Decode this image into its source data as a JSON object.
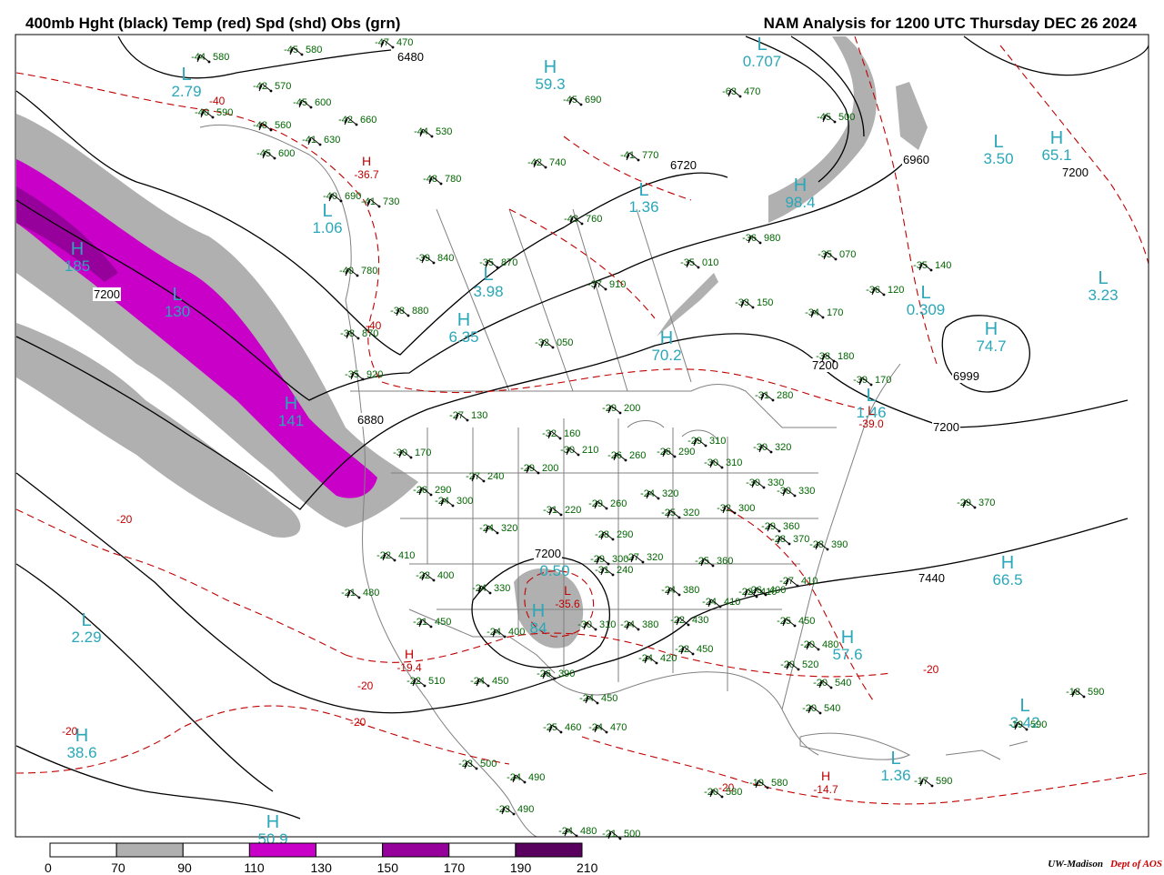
{
  "header": {
    "left_title": "400mb Hght (black) Temp (red) Spd (shd) Obs (grn)",
    "right_title": "NAM Analysis for 1200 UTC Thursday  DEC 26 2024"
  },
  "colors": {
    "height": "#000000",
    "temp": "#c00000",
    "obs": "#006400",
    "centers": "#2aa7b8",
    "border": "#808080",
    "shade_70": "#b0b0b0",
    "shade_110": "#c800c8",
    "shade_150": "#96009b",
    "shade_190": "#5a005f"
  },
  "legend": {
    "ticks": [
      "0",
      "70",
      "90",
      "110",
      "130",
      "150",
      "170",
      "190",
      "210"
    ],
    "fills": [
      "#ffffff",
      "#b0b0b0",
      "#ffffff",
      "#c800c8",
      "#ffffff",
      "#96009b",
      "#ffffff",
      "#5a005f"
    ]
  },
  "centers": [
    {
      "type": "L",
      "value": "2.79"
    },
    {
      "type": "L",
      "value": "1.06"
    },
    {
      "type": "H",
      "value": "185"
    },
    {
      "type": "L",
      "value": "130"
    },
    {
      "type": "L",
      "value": "3.98"
    },
    {
      "type": "H",
      "value": "59.3"
    },
    {
      "type": "L",
      "value": "1.36"
    },
    {
      "type": "L",
      "value": "0.707"
    },
    {
      "type": "H",
      "value": "98.4"
    },
    {
      "type": "L",
      "value": "3.50"
    },
    {
      "type": "H",
      "value": "65.1"
    },
    {
      "type": "L",
      "value": "3.23"
    },
    {
      "type": "L",
      "value": "0.309"
    },
    {
      "type": "H",
      "value": "74.7"
    },
    {
      "type": "H",
      "value": "6.35"
    },
    {
      "type": "H",
      "value": "70.2"
    },
    {
      "type": "H",
      "value": "141"
    },
    {
      "type": "L",
      "value": "1.46"
    },
    {
      "type": "H",
      "value": "66.5"
    },
    {
      "type": "L",
      "value": "2.29"
    },
    {
      "type": "H",
      "value": "38.6"
    },
    {
      "type": "H",
      "value": "57.6"
    },
    {
      "type": "L",
      "value": "3.42"
    },
    {
      "type": "L",
      "value": "1.36"
    },
    {
      "type": "H",
      "value": "50.9"
    },
    {
      "type": "L",
      "value": "0.50"
    },
    {
      "type": "H",
      "value": "84"
    }
  ],
  "temp_extremes": [
    {
      "type": "H",
      "value": "-36.7"
    },
    {
      "type": "H",
      "value": "-19.4"
    },
    {
      "type": "H",
      "value": "-14.7"
    },
    {
      "type": "L",
      "value": "-39.0"
    },
    {
      "type": "L",
      "value": "-35.6"
    }
  ],
  "height_labels": [
    "6480",
    "6720",
    "6960",
    "7200",
    "7200",
    "7200",
    "7200",
    "7440",
    "6999",
    "6880",
    "7200"
  ],
  "temp_labels": [
    "-40",
    "-40",
    "-20",
    "-20",
    "-20",
    "-20",
    "-20",
    "-20"
  ],
  "obs": [
    {
      "t": "-45",
      "h": "580"
    },
    {
      "t": "-44",
      "h": "580"
    },
    {
      "t": "-47",
      "h": "470"
    },
    {
      "t": "-42",
      "h": "570"
    },
    {
      "t": "-45",
      "h": "600"
    },
    {
      "t": "-40",
      "h": "590"
    },
    {
      "t": "-42",
      "h": "660"
    },
    {
      "t": "-48",
      "h": "560"
    },
    {
      "t": "-41",
      "h": "630"
    },
    {
      "t": "-45",
      "h": "600"
    },
    {
      "t": "-44",
      "h": "530"
    },
    {
      "t": "-48",
      "h": "780"
    },
    {
      "t": "-40",
      "h": "690"
    },
    {
      "t": "-41",
      "h": "730"
    },
    {
      "t": "-45",
      "h": "690"
    },
    {
      "t": "-42",
      "h": "740"
    },
    {
      "t": "-41",
      "h": "770"
    },
    {
      "t": "-43",
      "h": "760"
    },
    {
      "t": "-63",
      "h": "470"
    },
    {
      "t": "-45",
      "h": "500"
    },
    {
      "t": "-39",
      "h": "840"
    },
    {
      "t": "-35",
      "h": "870"
    },
    {
      "t": "-40",
      "h": "780"
    },
    {
      "t": "-38",
      "h": "880"
    },
    {
      "t": "-38",
      "h": "870"
    },
    {
      "t": "-37",
      "h": "910"
    },
    {
      "t": "-36",
      "h": "980"
    },
    {
      "t": "-35",
      "h": "010"
    },
    {
      "t": "-33",
      "h": "150"
    },
    {
      "t": "-34",
      "h": "170"
    },
    {
      "t": "-35",
      "h": "070"
    },
    {
      "t": "-36",
      "h": "120"
    },
    {
      "t": "-35",
      "h": "140"
    },
    {
      "t": "-32",
      "h": "050"
    },
    {
      "t": "-35",
      "h": "920"
    },
    {
      "t": "-38",
      "h": "180"
    },
    {
      "t": "-39",
      "h": "170"
    },
    {
      "t": "-31",
      "h": "280"
    },
    {
      "t": "-27",
      "h": "130"
    },
    {
      "t": "-29",
      "h": "200"
    },
    {
      "t": "-32",
      "h": "160"
    },
    {
      "t": "-30",
      "h": "210"
    },
    {
      "t": "-26",
      "h": "260"
    },
    {
      "t": "-26",
      "h": "290"
    },
    {
      "t": "-29",
      "h": "310"
    },
    {
      "t": "-30",
      "h": "320"
    },
    {
      "t": "-30",
      "h": "170"
    },
    {
      "t": "-26",
      "h": "290"
    },
    {
      "t": "-24",
      "h": "300"
    },
    {
      "t": "-27",
      "h": "240"
    },
    {
      "t": "-29",
      "h": "200"
    },
    {
      "t": "-30",
      "h": "310"
    },
    {
      "t": "-30",
      "h": "330"
    },
    {
      "t": "-30",
      "h": "330"
    },
    {
      "t": "-24",
      "h": "320"
    },
    {
      "t": "-32",
      "h": "300"
    },
    {
      "t": "-31",
      "h": "220"
    },
    {
      "t": "-29",
      "h": "260"
    },
    {
      "t": "-25",
      "h": "320"
    },
    {
      "t": "-24",
      "h": "320"
    },
    {
      "t": "-28",
      "h": "290"
    },
    {
      "t": "-29",
      "h": "300"
    },
    {
      "t": "-27",
      "h": "320"
    },
    {
      "t": "-29",
      "h": "360"
    },
    {
      "t": "-28",
      "h": "370"
    },
    {
      "t": "-28",
      "h": "390"
    },
    {
      "t": "-29",
      "h": "370"
    },
    {
      "t": "-22",
      "h": "410"
    },
    {
      "t": "-22",
      "h": "400"
    },
    {
      "t": "-24",
      "h": "330"
    },
    {
      "t": "-21",
      "h": "480"
    },
    {
      "t": "-31",
      "h": "240"
    },
    {
      "t": "-24",
      "h": "380"
    },
    {
      "t": "-24",
      "h": "410"
    },
    {
      "t": "-27",
      "h": "410"
    },
    {
      "t": "-22",
      "h": "410"
    },
    {
      "t": "-25",
      "h": "360"
    },
    {
      "t": "-26",
      "h": "400"
    },
    {
      "t": "-21",
      "h": "450"
    },
    {
      "t": "-24",
      "h": "400"
    },
    {
      "t": "-30",
      "h": "310"
    },
    {
      "t": "-24",
      "h": "380"
    },
    {
      "t": "-22",
      "h": "430"
    },
    {
      "t": "-25",
      "h": "450"
    },
    {
      "t": "-20",
      "h": "480"
    },
    {
      "t": "-22",
      "h": "450"
    },
    {
      "t": "-24",
      "h": "420"
    },
    {
      "t": "-20",
      "h": "520"
    },
    {
      "t": "-22",
      "h": "510"
    },
    {
      "t": "-24",
      "h": "450"
    },
    {
      "t": "-26",
      "h": "390"
    },
    {
      "t": "-24",
      "h": "450"
    },
    {
      "t": "-20",
      "h": "540"
    },
    {
      "t": "-20",
      "h": "540"
    },
    {
      "t": "-18",
      "h": "590"
    },
    {
      "t": "-25",
      "h": "460"
    },
    {
      "t": "-24",
      "h": "470"
    },
    {
      "t": "-19",
      "h": "590"
    },
    {
      "t": "-23",
      "h": "500"
    },
    {
      "t": "-24",
      "h": "490"
    },
    {
      "t": "-23",
      "h": "490"
    },
    {
      "t": "-19",
      "h": "580"
    },
    {
      "t": "-20",
      "h": "580"
    },
    {
      "t": "-17",
      "h": "590"
    },
    {
      "t": "-24",
      "h": "480"
    },
    {
      "t": "-21",
      "h": "500"
    }
  ],
  "credit": {
    "org": "UW-Madison",
    "dept": "Dept of AOS"
  }
}
